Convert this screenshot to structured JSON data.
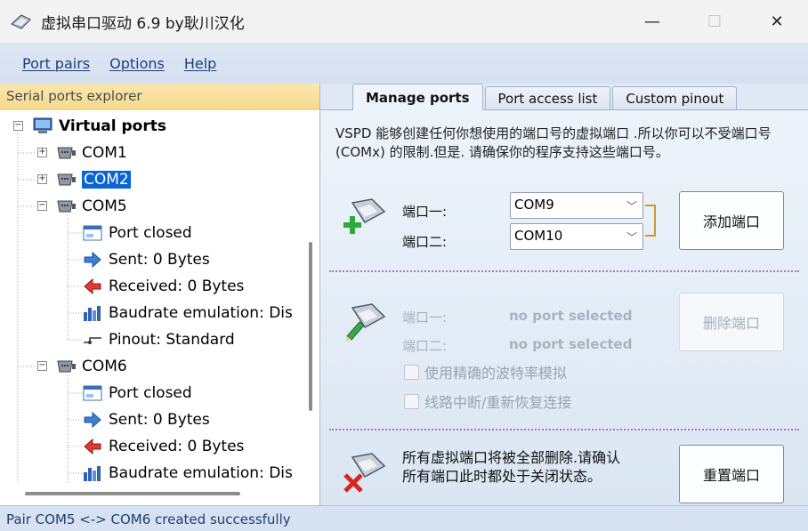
{
  "window": {
    "title": "虚拟串口驱动 6.9 by耿川汉化",
    "minimize_glyph": "—",
    "maximize_glyph": "☐",
    "close_glyph": "✕"
  },
  "menu": {
    "items": [
      "Port pairs",
      "Options",
      "Help"
    ]
  },
  "explorer": {
    "header": "Serial ports explorer",
    "root": "Virtual ports",
    "nodes": {
      "com1": "COM1",
      "com2": "COM2",
      "com5": "COM5",
      "com5_port_status": "Port closed",
      "com5_sent": "Sent: 0 Bytes",
      "com5_received": "Received: 0 Bytes",
      "com5_baudrate": "Baudrate emulation: Dis",
      "com5_pinout": "Pinout: Standard",
      "com6": "COM6",
      "com6_port_status": "Port closed",
      "com6_sent": "Sent: 0 Bytes",
      "com6_received": "Received: 0 Bytes",
      "com6_baudrate": "Baudrate emulation: Dis"
    },
    "expander_plus": "+",
    "expander_minus": "−"
  },
  "tabs": [
    "Manage ports",
    "Port access list",
    "Custom pinout"
  ],
  "manage": {
    "description": "VSPD 能够创建任何你想使用的端口号的虚拟端口 .所以你可以不受端口号(COMx) 的限制.但是. 请确保你的程序支持这些端口号。",
    "add": {
      "label1": "端口一:",
      "label2": "端口二:",
      "port1": "COM9",
      "port2": "COM10",
      "button": "添加端口"
    },
    "remove": {
      "label1": "端口一:",
      "label2": "端口二:",
      "value1": "no port selected",
      "value2": "no port selected",
      "button": "删除端口"
    },
    "options": {
      "strict_baud": "使用精确的波特率模拟",
      "reconnect": "线路中断/重新恢复连接"
    },
    "reset": {
      "text": "所有虚拟端口将被全部删除.请确认所有端口此时都处于关闭状态。",
      "button": "重置端口"
    }
  },
  "status": {
    "text": "Pair COM5 <-> COM6 created successfully"
  },
  "colors": {
    "selection": "#0a64d6",
    "explorer_header": "#f4d88c",
    "panel_bg": "#dfe8f4"
  }
}
